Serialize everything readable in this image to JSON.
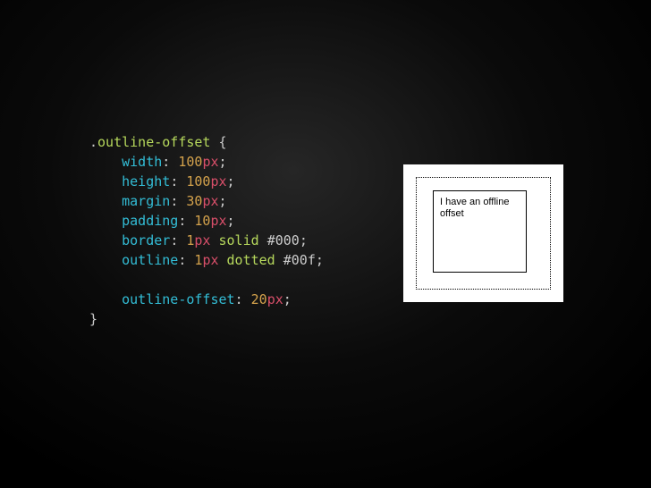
{
  "code": {
    "selector_dot": ".",
    "selector": "outline-offset",
    "open": " {",
    "lines": [
      {
        "prop": "width",
        "colon": ": ",
        "val": [
          {
            "t": "num",
            "s": "100"
          },
          {
            "t": "unit",
            "s": "px"
          }
        ],
        "semi": ";"
      },
      {
        "prop": "height",
        "colon": ": ",
        "val": [
          {
            "t": "num",
            "s": "100"
          },
          {
            "t": "unit",
            "s": "px"
          }
        ],
        "semi": ";"
      },
      {
        "prop": "margin",
        "colon": ": ",
        "val": [
          {
            "t": "num",
            "s": "30"
          },
          {
            "t": "unit",
            "s": "px"
          }
        ],
        "semi": ";"
      },
      {
        "prop": "padding",
        "colon": ": ",
        "val": [
          {
            "t": "num",
            "s": "10"
          },
          {
            "t": "unit",
            "s": "px"
          }
        ],
        "semi": ";"
      },
      {
        "prop": "border",
        "colon": ": ",
        "val": [
          {
            "t": "num",
            "s": "1"
          },
          {
            "t": "unit",
            "s": "px"
          },
          {
            "t": "sp",
            "s": " "
          },
          {
            "t": "word",
            "s": "solid"
          },
          {
            "t": "sp",
            "s": " "
          },
          {
            "t": "hex",
            "s": "#000"
          }
        ],
        "semi": ";"
      },
      {
        "prop": "outline",
        "colon": ": ",
        "val": [
          {
            "t": "num",
            "s": "1"
          },
          {
            "t": "unit",
            "s": "px"
          },
          {
            "t": "sp",
            "s": " "
          },
          {
            "t": "word",
            "s": "dotted"
          },
          {
            "t": "sp",
            "s": " "
          },
          {
            "t": "hex",
            "s": "#00f"
          }
        ],
        "semi": ";"
      }
    ],
    "blank": "",
    "last": {
      "prop": "outline-offset",
      "colon": ": ",
      "val": [
        {
          "t": "num",
          "s": "20"
        },
        {
          "t": "unit",
          "s": "px"
        }
      ],
      "semi": ";"
    },
    "close": "}"
  },
  "demo": {
    "text": "I have an offline offset"
  }
}
